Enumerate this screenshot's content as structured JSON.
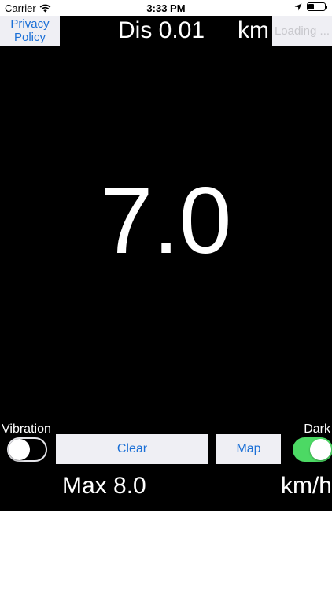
{
  "status_bar": {
    "carrier": "Carrier",
    "time": "3:33 PM",
    "wifi_icon": "wifi-icon",
    "location_icon": "location-arrow-icon",
    "battery_icon": "battery-icon",
    "battery_level": 0.35
  },
  "top": {
    "privacy_label": "Privacy Policy",
    "distance_label": "Dis 0.01",
    "distance_unit": "km",
    "loading_label": "Loading ..."
  },
  "speed": {
    "current": "7.0",
    "max_label": "Max 8.0",
    "unit": "km/h"
  },
  "controls": {
    "vibration_label": "Vibration",
    "vibration_on": false,
    "dark_label": "Dark",
    "dark_on": true,
    "clear_label": "Clear",
    "map_label": "Map",
    "switch_on_color": "#4cd964",
    "button_text_color": "#1a6fd6"
  }
}
